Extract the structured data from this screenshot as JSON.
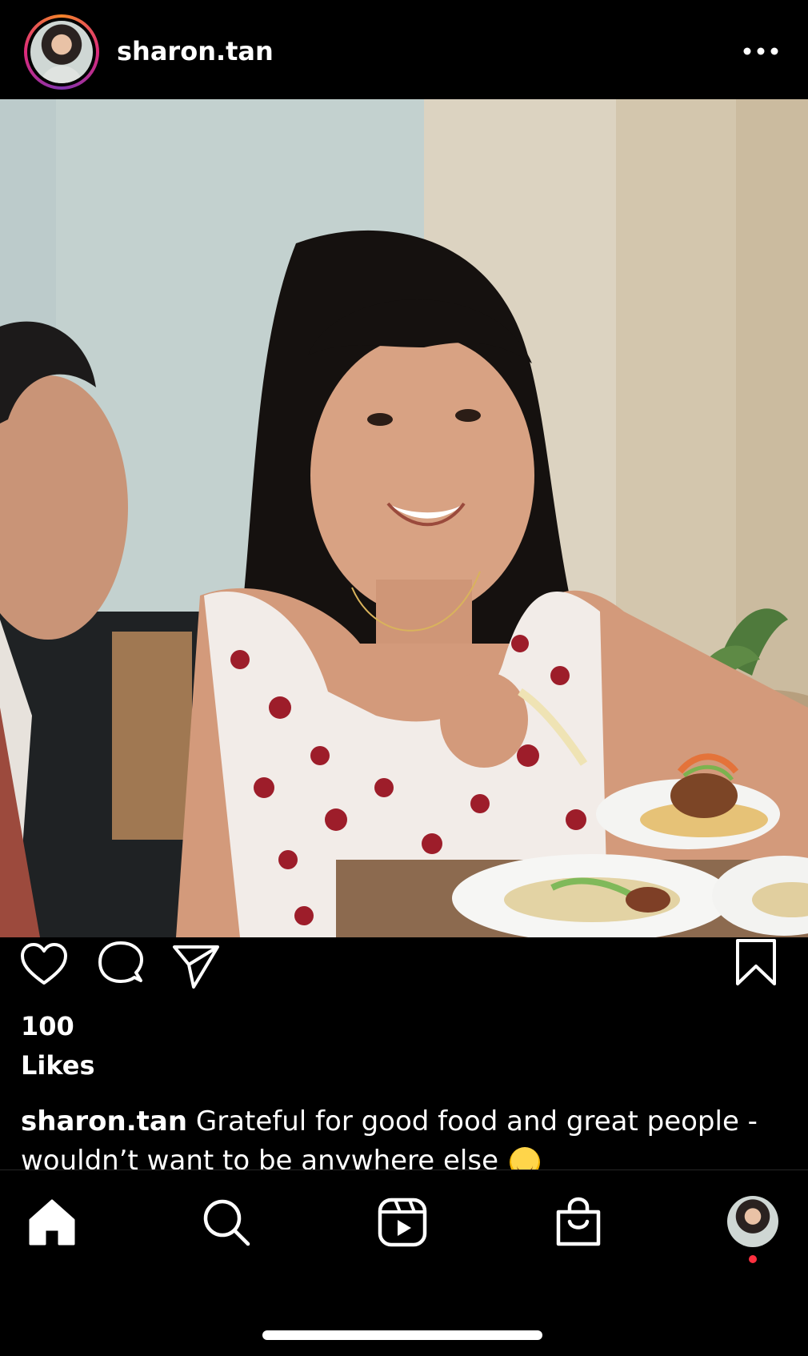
{
  "post": {
    "username": "sharon.tan",
    "likes_count": "100",
    "likes_label": "Likes",
    "caption_text": "Grateful for good food and great people - wouldn’t want to be anywhere else",
    "caption_emoji": "smiling-face-with-hearts"
  },
  "icons": {
    "more": "more-horizontal-icon",
    "like": "heart-icon",
    "comment": "comment-icon",
    "share": "send-icon",
    "save": "bookmark-icon"
  },
  "tabs": [
    {
      "name": "home",
      "icon": "home-icon",
      "active": true
    },
    {
      "name": "search",
      "icon": "search-icon"
    },
    {
      "name": "reels",
      "icon": "reels-icon"
    },
    {
      "name": "shop",
      "icon": "shopping-bag-icon"
    },
    {
      "name": "profile",
      "icon": "profile-avatar",
      "has_notification": true
    }
  ],
  "colors": {
    "background": "#000000",
    "text": "#ffffff",
    "notification": "#ff3040",
    "story_ring": [
      "#f58529",
      "#dd2a7b",
      "#8134af"
    ]
  }
}
